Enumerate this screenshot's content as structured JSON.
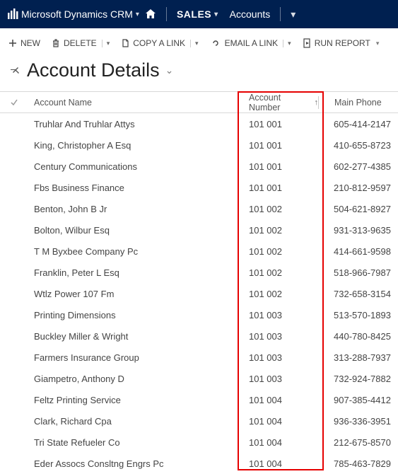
{
  "topnav": {
    "brand": "Microsoft Dynamics CRM",
    "sales": "SALES",
    "accounts": "Accounts"
  },
  "commands": {
    "new": "NEW",
    "delete": "DELETE",
    "copylink": "COPY A LINK",
    "emaillink": "EMAIL A LINK",
    "runreport": "RUN REPORT"
  },
  "page": {
    "title": "Account Details"
  },
  "grid": {
    "headers": {
      "name": "Account Name",
      "acct": "Account Number",
      "phone": "Main Phone"
    },
    "rows": [
      {
        "name": "Truhlar And Truhlar Attys",
        "acct": "101 001",
        "phone": "605-414-2147"
      },
      {
        "name": "King, Christopher A Esq",
        "acct": "101 001",
        "phone": "410-655-8723"
      },
      {
        "name": "Century Communications",
        "acct": "101 001",
        "phone": "602-277-4385"
      },
      {
        "name": "Fbs Business Finance",
        "acct": "101 001",
        "phone": "210-812-9597"
      },
      {
        "name": "Benton, John B Jr",
        "acct": "101 002",
        "phone": "504-621-8927"
      },
      {
        "name": "Bolton, Wilbur Esq",
        "acct": "101 002",
        "phone": "931-313-9635"
      },
      {
        "name": "T M Byxbee Company Pc",
        "acct": "101 002",
        "phone": "414-661-9598"
      },
      {
        "name": "Franklin, Peter L Esq",
        "acct": "101 002",
        "phone": "518-966-7987"
      },
      {
        "name": "Wtlz Power 107 Fm",
        "acct": "101 002",
        "phone": "732-658-3154"
      },
      {
        "name": "Printing Dimensions",
        "acct": "101 003",
        "phone": "513-570-1893"
      },
      {
        "name": "Buckley Miller & Wright",
        "acct": "101 003",
        "phone": "440-780-8425"
      },
      {
        "name": "Farmers Insurance Group",
        "acct": "101 003",
        "phone": "313-288-7937"
      },
      {
        "name": "Giampetro, Anthony D",
        "acct": "101 003",
        "phone": "732-924-7882"
      },
      {
        "name": "Feltz Printing Service",
        "acct": "101 004",
        "phone": "907-385-4412"
      },
      {
        "name": "Clark, Richard Cpa",
        "acct": "101 004",
        "phone": "936-336-3951"
      },
      {
        "name": "Tri State Refueler Co",
        "acct": "101 004",
        "phone": "212-675-8570"
      },
      {
        "name": "Eder Assocs Consltng Engrs Pc",
        "acct": "101 004",
        "phone": "785-463-7829"
      }
    ]
  }
}
